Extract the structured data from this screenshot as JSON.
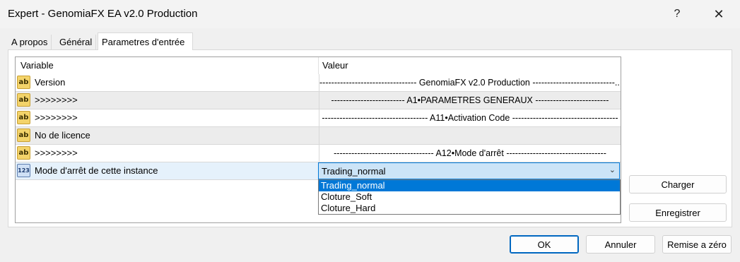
{
  "window": {
    "title": "Expert - GenomiaFX EA v2.0 Production",
    "help_glyph": "?",
    "close_glyph": "✕"
  },
  "tabs": [
    {
      "label": "A propos"
    },
    {
      "label": "Général"
    },
    {
      "label": "Parametres d'entrée",
      "active": true
    }
  ],
  "grid": {
    "columns": {
      "variable": "Variable",
      "value": "Valeur"
    },
    "rows": [
      {
        "icon": "ab",
        "variable": "Version",
        "value": "--------------------------------- GenomiaFX v2.0 Production ----------------------------..."
      },
      {
        "icon": "ab",
        "variable": ">>>>>>>>",
        "value": "------------------------- A1•PARAMETRES GENERAUX -------------------------"
      },
      {
        "icon": "ab",
        "variable": ">>>>>>>>",
        "value": "------------------------------------ A11•Activation Code ------------------------------------"
      },
      {
        "icon": "",
        "variable": "No de licence",
        "value": ""
      },
      {
        "icon": "ab",
        "variable": ">>>>>>>>",
        "value": "---------------------------------- A12•Mode d'arrêt ----------------------------------"
      },
      {
        "icon": "123",
        "variable": "Mode d'arrêt de cette instance",
        "value": "Trading_normal"
      }
    ]
  },
  "dropdown": {
    "selected": "Trading_normal",
    "options": [
      "Trading_normal",
      "Cloture_Soft",
      "Cloture_Hard"
    ]
  },
  "side_buttons": {
    "load": "Charger",
    "save": "Enregistrer"
  },
  "footer_buttons": {
    "ok": "OK",
    "cancel": "Annuler",
    "reset": "Remise a zéro"
  },
  "colors": {
    "accent": "#0078d7",
    "selected_row": "#e5f1fb",
    "header_row": "#ececec"
  }
}
